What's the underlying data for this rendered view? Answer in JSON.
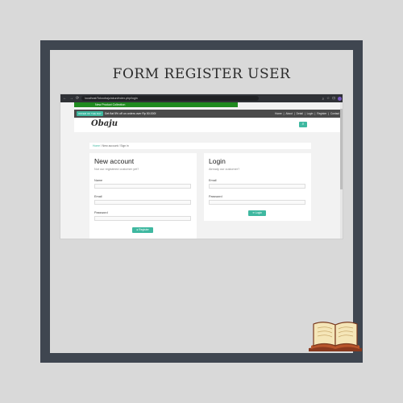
{
  "poster": {
    "title": "FORM REGISTER USER"
  },
  "browser": {
    "nav_icons": [
      "←",
      "→",
      "⟳"
    ],
    "address": "localhost/Tokoobaju/akun/index.php/login",
    "tools": [
      "⌕",
      "☆",
      "⊡"
    ]
  },
  "site": {
    "promo_strip": "New Product Collection",
    "topbar_badge": "OFFER OF THE DAY",
    "topbar_promo": "Get flat 5% off on orders over Rp 50.000!",
    "topnav": [
      "Home",
      "|",
      "About",
      "|",
      "Detail",
      "|",
      "Login",
      "|",
      "Register",
      "|",
      "Contact"
    ],
    "logo": "Obaju",
    "search_icon": "⌕",
    "breadcrumb": {
      "home": "Home",
      "sep": " / ",
      "current": "New account / Sign in"
    }
  },
  "register": {
    "title": "New account",
    "subtitle": "Not our registered customer yet?",
    "name_label": "Name",
    "email_label": "Email",
    "password_label": "Password",
    "button": "Register"
  },
  "login": {
    "title": "Login",
    "subtitle": "Already our customer?",
    "email_label": "Email",
    "password_label": "Password",
    "button": "Login"
  }
}
